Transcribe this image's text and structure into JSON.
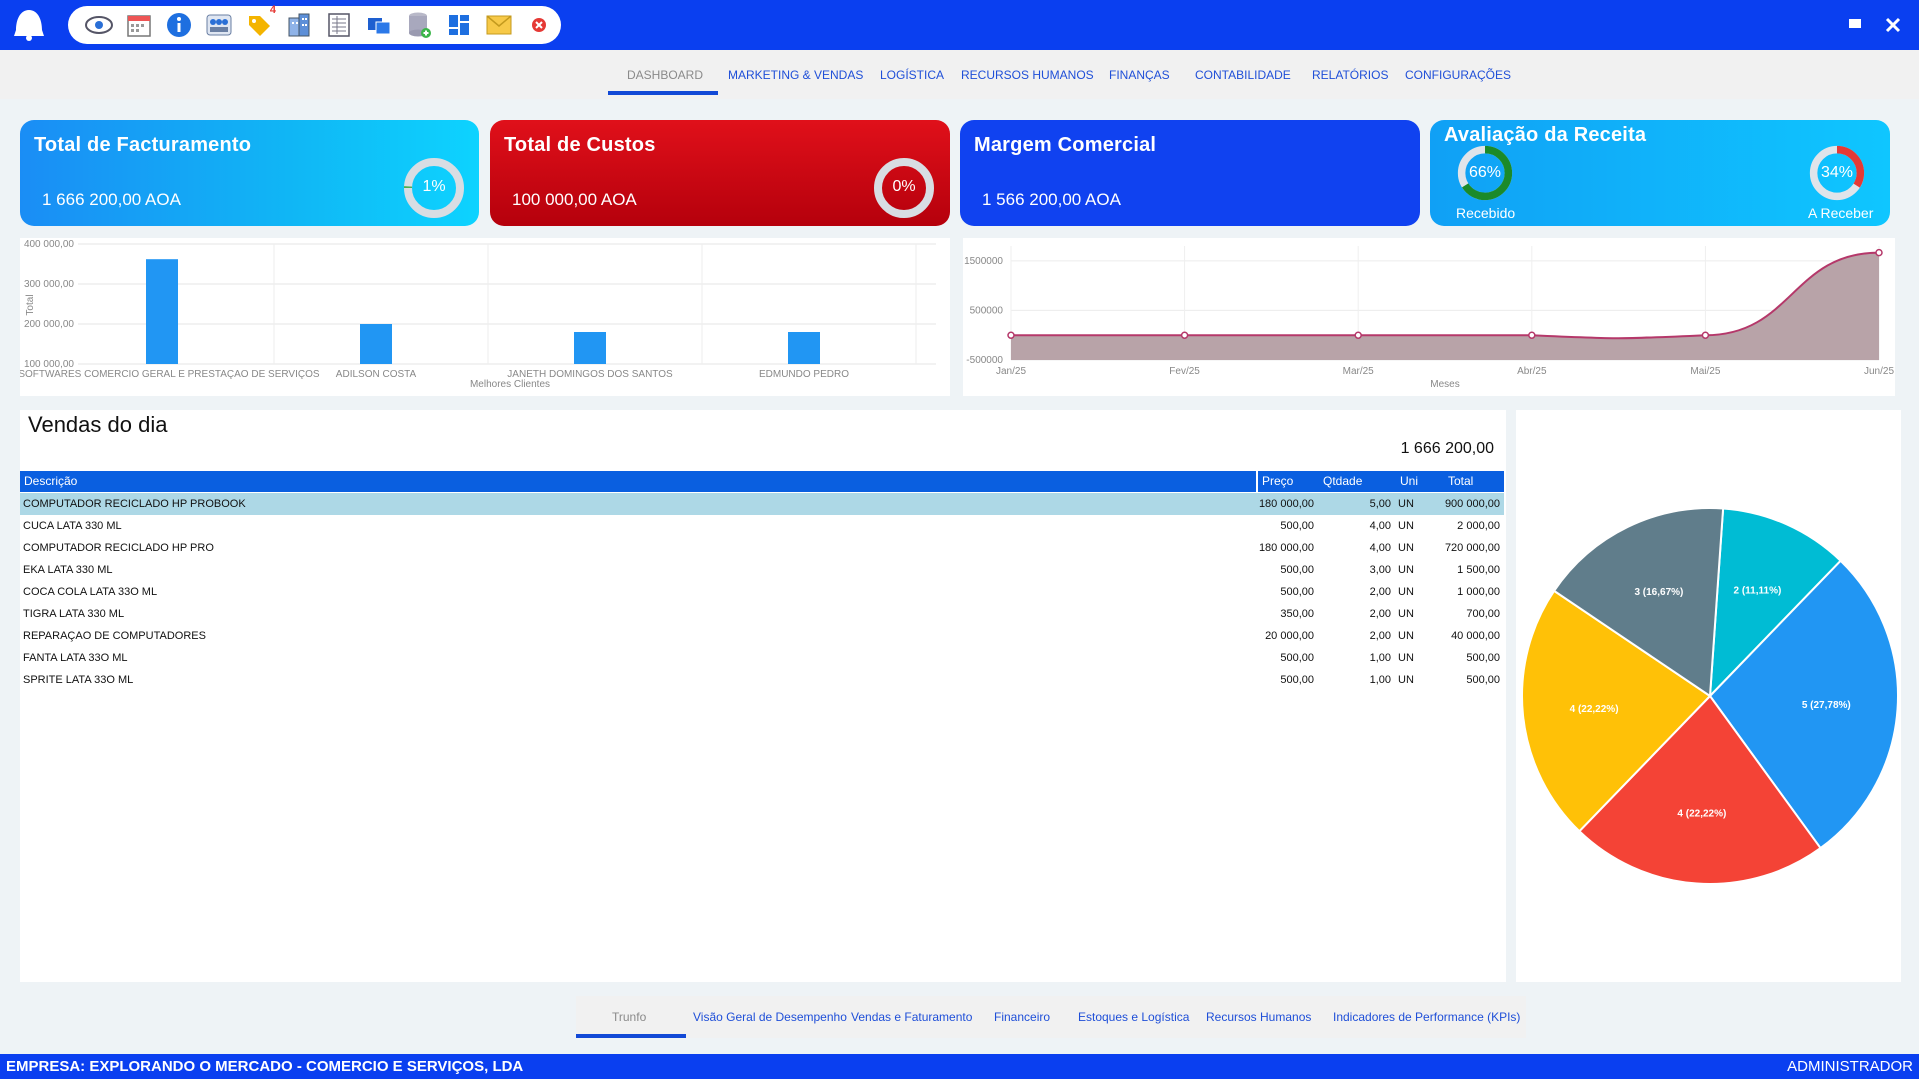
{
  "nav": {
    "items": [
      "DASHBOARD",
      "MARKETING & VENDAS",
      "LOGÍSTICA",
      "RECURSOS HUMANOS",
      "FINANÇAS",
      "CONTABILIDADE",
      "RELATÓRIOS",
      "CONFIGURAÇÕES"
    ],
    "active": "DASHBOARD"
  },
  "toolbar": {
    "icons": [
      "eye-icon",
      "calendar-icon",
      "info-icon",
      "users-icon",
      "tag-icon",
      "building-icon",
      "document-icon",
      "windows-icon",
      "database-icon",
      "dashboard-icon",
      "mail-icon",
      "close-circle-icon"
    ],
    "badge": "4"
  },
  "kpis": {
    "facturamento": {
      "title": "Total de Facturamento",
      "value": "1 666 200,00 AOA",
      "percent": "1%",
      "percent_value": 1
    },
    "custos": {
      "title": "Total de Custos",
      "value": "100 000,00 AOA",
      "percent": "0%",
      "percent_value": 0
    },
    "margem": {
      "title": "Margem Comercial",
      "value": "1 566 200,00 AOA"
    },
    "receita": {
      "title": "Avaliação da Receita",
      "recebido_pct": "66%",
      "recebido_value": 66,
      "recebido_label": "Recebido",
      "receber_pct": "34%",
      "receber_value": 34,
      "receber_label": "A Receber"
    }
  },
  "chart_data": [
    {
      "type": "bar",
      "categories": [
        "NPSOFTWARES COMERCIO GERAL E PRESTAÇAO DE SERVIÇOS",
        "ADILSON COSTA",
        "JANETH DOMINGOS DOS SANTOS",
        "EDMUNDO PEDRO"
      ],
      "values": [
        362000,
        200000,
        180000,
        180000
      ],
      "xlabel": "Melhores Clientes",
      "ylabel": "Total",
      "yticks": [
        "400 000,00",
        "300 000,00",
        "200 000,00",
        "100 000,00"
      ],
      "ylim": [
        100000,
        400000
      ],
      "color": "#2196f3"
    },
    {
      "type": "area",
      "x": [
        "Jan/25",
        "Fev/25",
        "Mar/25",
        "Abr/25",
        "Mai/25",
        "Jun/25"
      ],
      "values": [
        0,
        0,
        0,
        0,
        0,
        1666200
      ],
      "xlabel": "Meses",
      "yticks": [
        "1500000",
        "500000",
        "-500000"
      ],
      "ylim": [
        -500000,
        1800000
      ],
      "color": "#b5386a",
      "fill": "#b8a3a8"
    },
    {
      "type": "pie",
      "slices": [
        {
          "label": "2 (11,11%)",
          "value": 2,
          "color": "#00bcd4"
        },
        {
          "label": "5 (27,78%)",
          "value": 5,
          "color": "#2196f3"
        },
        {
          "label": "4 (22,22%)",
          "value": 4,
          "color": "#f44336"
        },
        {
          "label": "4 (22,22%)",
          "value": 4,
          "color": "#ffc107"
        },
        {
          "label": "3 (16,67%)",
          "value": 3,
          "color": "#607d8b"
        }
      ]
    }
  ],
  "vendas": {
    "title": "Vendas do dia",
    "total": "1 666 200,00",
    "headers": {
      "descricao": "Descrição",
      "preco": "Preço",
      "qtdade": "Qtdade",
      "uni": "Uni",
      "total": "Total"
    },
    "rows": [
      {
        "descricao": "COMPUTADOR RECICLADO HP PROBOOK",
        "preco": "180 000,00",
        "qtdade": "5,00",
        "uni": "UN",
        "total": "900 000,00"
      },
      {
        "descricao": "CUCA LATA 330 ML",
        "preco": "500,00",
        "qtdade": "4,00",
        "uni": "UN",
        "total": "2 000,00"
      },
      {
        "descricao": "COMPUTADOR RECICLADO HP PRO",
        "preco": "180 000,00",
        "qtdade": "4,00",
        "uni": "UN",
        "total": "720 000,00"
      },
      {
        "descricao": "EKA LATA 330 ML",
        "preco": "500,00",
        "qtdade": "3,00",
        "uni": "UN",
        "total": "1 500,00"
      },
      {
        "descricao": "COCA COLA LATA 33O ML",
        "preco": "500,00",
        "qtdade": "2,00",
        "uni": "UN",
        "total": "1 000,00"
      },
      {
        "descricao": "TIGRA LATA 330 ML",
        "preco": "350,00",
        "qtdade": "2,00",
        "uni": "UN",
        "total": "700,00"
      },
      {
        "descricao": "REPARAÇAO DE COMPUTADORES",
        "preco": "20 000,00",
        "qtdade": "2,00",
        "uni": "UN",
        "total": "40 000,00"
      },
      {
        "descricao": "FANTA LATA 33O ML",
        "preco": "500,00",
        "qtdade": "1,00",
        "uni": "UN",
        "total": "500,00"
      },
      {
        "descricao": "SPRITE LATA 33O ML",
        "preco": "500,00",
        "qtdade": "1,00",
        "uni": "UN",
        "total": "500,00"
      }
    ]
  },
  "bottom_tabs": {
    "items": [
      "Trunfo",
      "Visão Geral de Desempenho",
      "Vendas e Faturamento",
      "Financeiro",
      "Estoques e Logística",
      "Recursos Humanos",
      "Indicadores de Performance (KPIs)"
    ],
    "active": "Trunfo"
  },
  "status": {
    "empresa": "EMPRESA: EXPLORANDO O MERCADO - COMERCIO E SERVIÇOS, LDA",
    "user": "ADMINISTRADOR"
  },
  "colors": {
    "titlebar": "#0a3ff0",
    "accent": "#1249d6",
    "custos": "#c8000f",
    "margem": "#1042f0"
  }
}
